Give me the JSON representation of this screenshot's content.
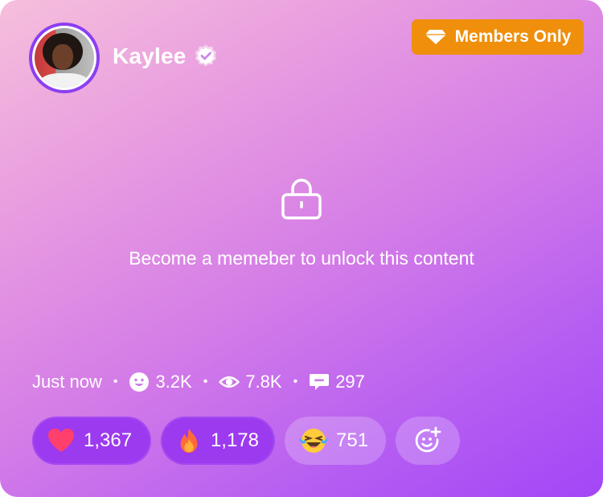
{
  "profile": {
    "name": "Kaylee",
    "verified_icon": "verified-badge-icon"
  },
  "badge": {
    "label": "Members Only",
    "icon": "diamond-icon",
    "color": "#ef8f0c"
  },
  "locked": {
    "icon": "lock-icon",
    "message": "Become a memeber to unlock this content"
  },
  "meta": {
    "time": "Just now",
    "reactions_count": "3.2K",
    "views_count": "7.8K",
    "comments_count": "297"
  },
  "reactions": [
    {
      "icon": "heart-icon",
      "count": "1,367"
    },
    {
      "icon": "fire-icon",
      "count": "1,178"
    },
    {
      "icon": "laughing-emoji-icon",
      "count": "751"
    }
  ],
  "add_reaction_icon": "add-reaction-icon"
}
